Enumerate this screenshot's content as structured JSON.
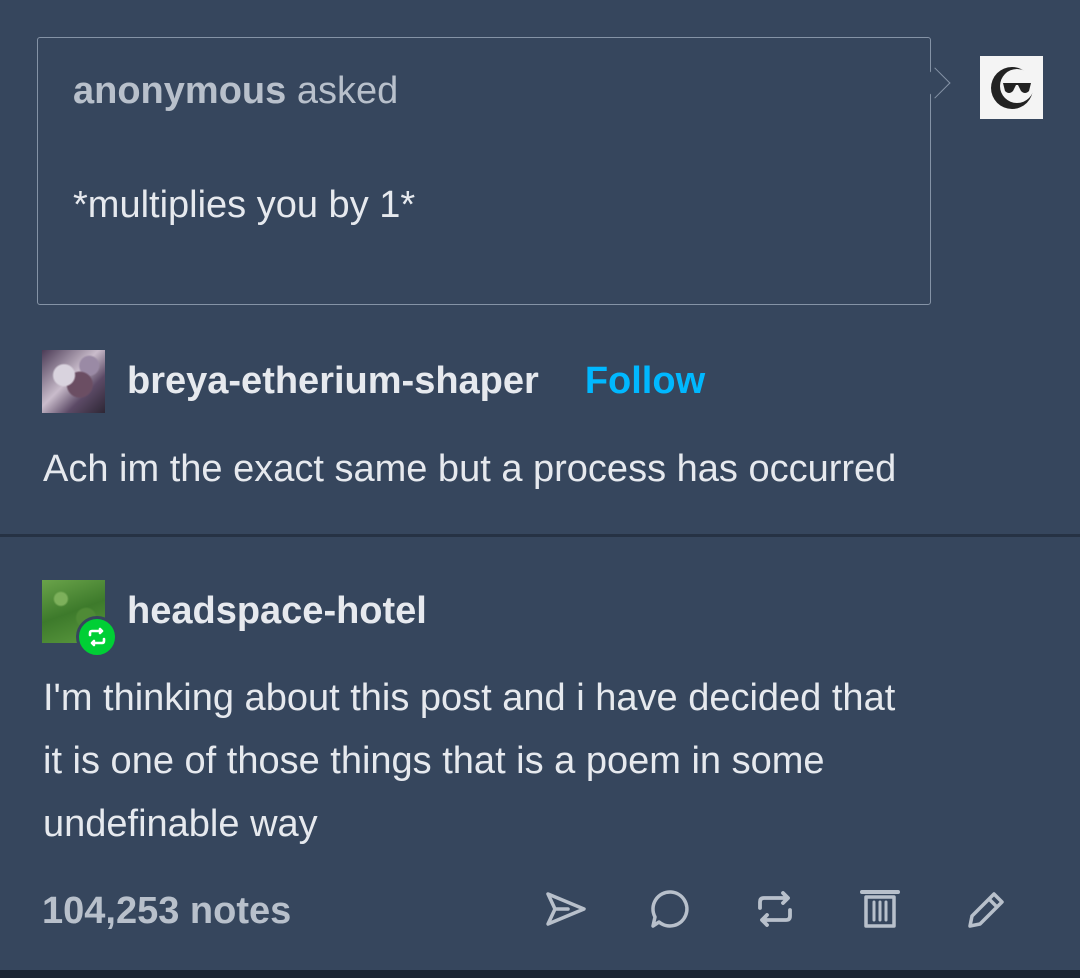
{
  "ask": {
    "asker": "anonymous",
    "asked_label": "asked",
    "question": "*multiplies you by 1*"
  },
  "answer": {
    "username": "breya-etherium-shaper",
    "follow_label": "Follow",
    "text": "Ach im the exact same but a process has occurred"
  },
  "reblog": {
    "username": "headspace-hotel",
    "text_lines": [
      "I'm thinking about this post and i have decided that",
      "it is one of those things that is a poem in some",
      "undefinable way"
    ]
  },
  "footer": {
    "notes": "104,253 notes",
    "actions": [
      "share-icon",
      "reply-icon",
      "reblog-icon",
      "delete-icon",
      "edit-icon"
    ]
  },
  "colors": {
    "background": "#36465d",
    "follow": "#00b8ff",
    "reblog_badge": "#00cf35"
  }
}
